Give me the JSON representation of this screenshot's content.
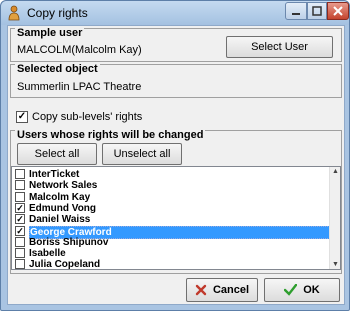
{
  "window": {
    "title": "Copy rights",
    "controls": {
      "minimize": "─",
      "maximize": "□",
      "close": "✕"
    }
  },
  "sample_user": {
    "group_label": "Sample user",
    "value": "MALCOLM(Malcolm Kay)",
    "button_label": "Select User"
  },
  "selected_object": {
    "group_label": "Selected object",
    "value": "Summerlin LPAC Theatre"
  },
  "copy_sublevels": {
    "label": "Copy sub-levels' rights",
    "checked": true
  },
  "users": {
    "group_label": "Users whose rights will be changed",
    "select_all_label": "Select all",
    "unselect_all_label": "Unselect all",
    "items": [
      {
        "name": "InterTicket",
        "checked": false,
        "selected": false
      },
      {
        "name": "Network Sales",
        "checked": false,
        "selected": false
      },
      {
        "name": "Malcolm Kay",
        "checked": false,
        "selected": false
      },
      {
        "name": "Edmund Vong",
        "checked": true,
        "selected": false
      },
      {
        "name": "Daniel Waiss",
        "checked": true,
        "selected": false
      },
      {
        "name": "George Crawford",
        "checked": true,
        "selected": true
      },
      {
        "name": "Boriss Shipunov",
        "checked": false,
        "selected": false
      },
      {
        "name": "Isabelle",
        "checked": false,
        "selected": false
      },
      {
        "name": "Julia Copeland",
        "checked": false,
        "selected": false
      }
    ]
  },
  "footer": {
    "cancel_label": "Cancel",
    "ok_label": "OK",
    "cancel_icon_color": "#c0392b",
    "ok_icon_color": "#2e9e2e"
  }
}
